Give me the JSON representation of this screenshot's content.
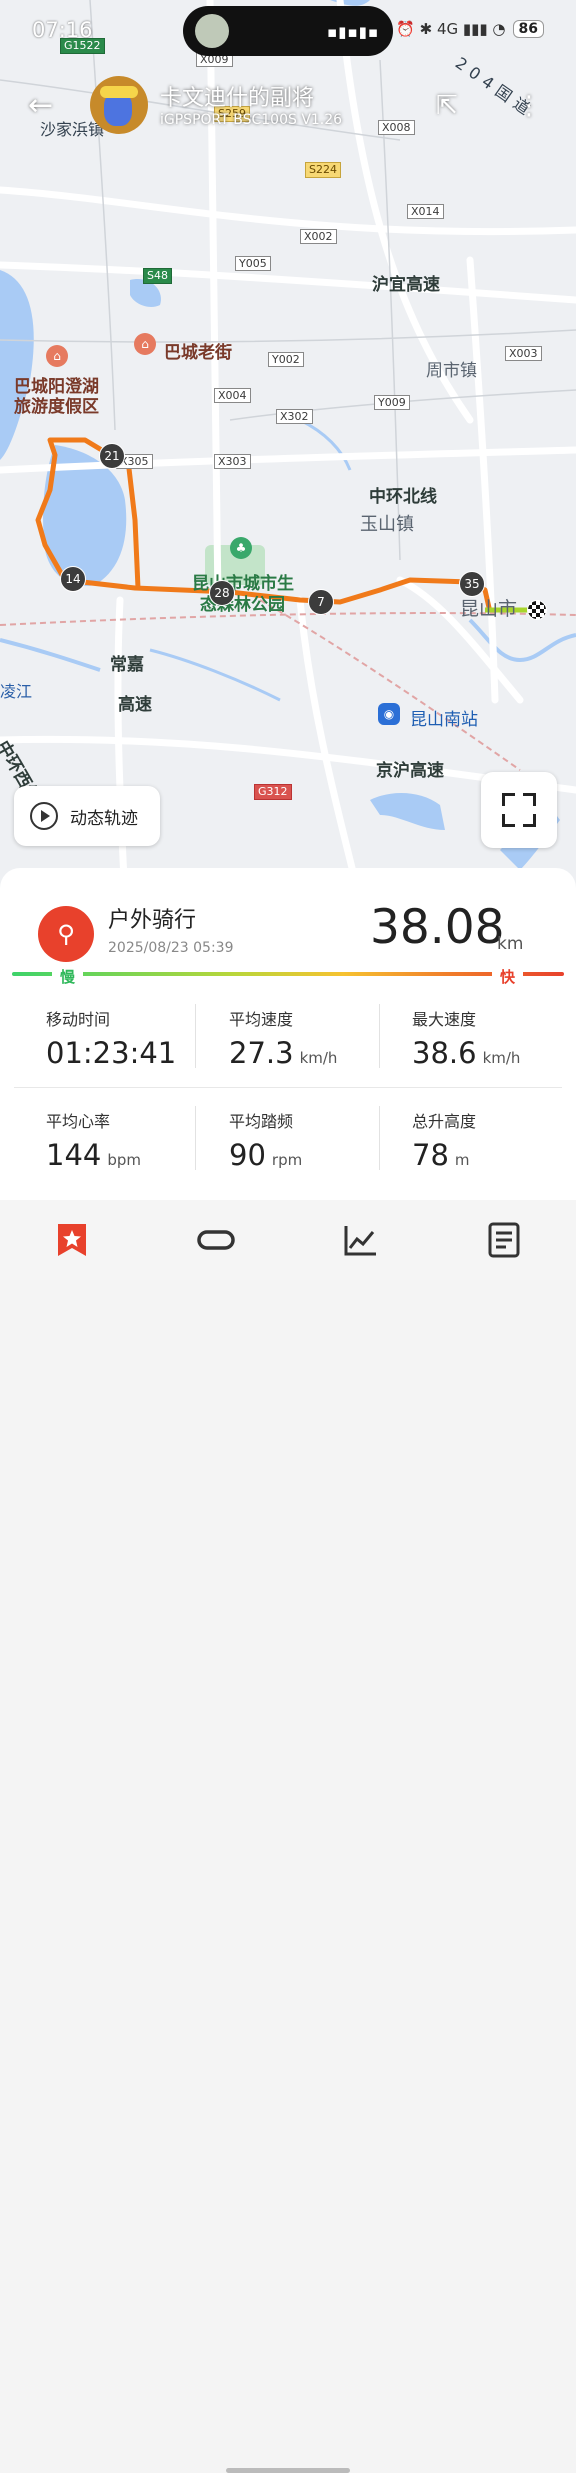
{
  "status_bar": {
    "time": "07:16",
    "icons": "⏰ ✱ 4G ▮▮▮ ◔",
    "battery": "86",
    "island_wave": "▪▮▪▮▪"
  },
  "header": {
    "username": "卡文迪什的副将",
    "device": "iGPSPORT BSC100S  V1.26",
    "back_icon": "←",
    "share_icon": "⇱",
    "more_icon": "⋮"
  },
  "map": {
    "labels": {
      "shajiabang": "沙家浜镇",
      "huyi": "沪宜高速",
      "bacheng": "巴城老街",
      "zhoushi": "周市镇",
      "yangcheng1": "巴城阳澄湖",
      "yangcheng2": "旅游度假区",
      "zhonghuanbei": "中环北线",
      "yushan": "玉山镇",
      "park1": "昆山市城市生",
      "park2": "态森林公园",
      "kunshan": "昆山市",
      "changjia1": "常嘉",
      "changjia2": "高速",
      "kunshannan": "昆山南站",
      "jinghu": "京沪高速",
      "zhonghuan": "中环西线",
      "lingjiang": "凌江",
      "g204": "204国道"
    },
    "roads": {
      "x009": "X009",
      "g1522": "G1522",
      "s259": "S259",
      "x008": "X008",
      "s224": "S224",
      "x014": "X014",
      "x002": "X002",
      "y005": "Y005",
      "s48": "S48",
      "x003": "X003",
      "y002": "Y002",
      "x004": "X004",
      "y009": "Y009",
      "x302": "X302",
      "x305": "X305",
      "x303": "X303",
      "g312": "G312"
    },
    "markers": {
      "k21": "21",
      "k14": "14",
      "k28": "28",
      "k7": "7",
      "k35": "35"
    },
    "route_color": "#f07a1a"
  },
  "replay": {
    "label": "动态轨迹"
  },
  "activity": {
    "type": "户外骑行",
    "date": "2025/08/23 05:39",
    "distance": "38.08",
    "distance_unit": "km",
    "slow_label": "慢",
    "fast_label": "快",
    "stats": [
      {
        "label": "移动时间",
        "value": "01:23:41",
        "unit": ""
      },
      {
        "label": "平均速度",
        "value": "27.3",
        "unit": "km/h"
      },
      {
        "label": "最大速度",
        "value": "38.6",
        "unit": "km/h"
      },
      {
        "label": "平均心率",
        "value": "144",
        "unit": "bpm"
      },
      {
        "label": "平均踏频",
        "value": "90",
        "unit": "rpm"
      },
      {
        "label": "总升高度",
        "value": "78",
        "unit": "m"
      }
    ]
  },
  "colors": {
    "accent": "#e8412c",
    "slow": "#2fb85a"
  }
}
